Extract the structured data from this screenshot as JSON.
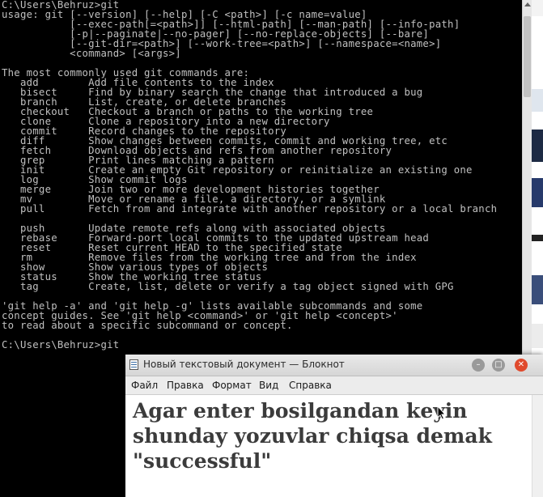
{
  "console": {
    "lines": [
      "C:\\Users\\Behruz>git",
      "usage: git [--version] [--help] [-C <path>] [-c name=value]",
      "           [--exec-path[=<path>]] [--html-path] [--man-path] [--info-path]",
      "           [-p|--paginate|--no-pager] [--no-replace-objects] [--bare]",
      "           [--git-dir=<path>] [--work-tree=<path>] [--namespace=<name>]",
      "           <command> [<args>]",
      "",
      "The most commonly used git commands are:",
      "   add        Add file contents to the index",
      "   bisect     Find by binary search the change that introduced a bug",
      "   branch     List, create, or delete branches",
      "   checkout   Checkout a branch or paths to the working tree",
      "   clone      Clone a repository into a new directory",
      "   commit     Record changes to the repository",
      "   diff       Show changes between commits, commit and working tree, etc",
      "   fetch      Download objects and refs from another repository",
      "   grep       Print lines matching a pattern",
      "   init       Create an empty Git repository or reinitialize an existing one",
      "   log        Show commit logs",
      "   merge      Join two or more development histories together",
      "   mv         Move or rename a file, a directory, or a symlink",
      "   pull       Fetch from and integrate with another repository or a local branch",
      "",
      "   push       Update remote refs along with associated objects",
      "   rebase     Forward-port local commits to the updated upstream head",
      "   reset      Reset current HEAD to the specified state",
      "   rm         Remove files from the working tree and from the index",
      "   show       Show various types of objects",
      "   status     Show the working tree status",
      "   tag        Create, list, delete or verify a tag object signed with GPG",
      "",
      "'git help -a' and 'git help -g' lists available subcommands and some",
      "concept guides. See 'git help <command>' or 'git help <concept>'",
      "to read about a specific subcommand or concept.",
      "",
      "C:\\Users\\Behruz>git"
    ],
    "text_color": "#c0c0c0",
    "background": "#000000"
  },
  "notepad": {
    "title": "Новый текстовый документ — Блокнот",
    "menu": [
      "Файл",
      "Правка",
      "Формат",
      "Вид",
      "Справка"
    ],
    "content": "Agar enter bosilgandan keyin shunday yozuvlar chiqsa demak \"successful\"",
    "close_color": "#e04a2d"
  },
  "icons": {
    "app": "notepad-icon",
    "minimize": "minimize-icon",
    "maximize": "maximize-icon",
    "close": "close-icon",
    "cursor": "text-cursor-icon"
  }
}
